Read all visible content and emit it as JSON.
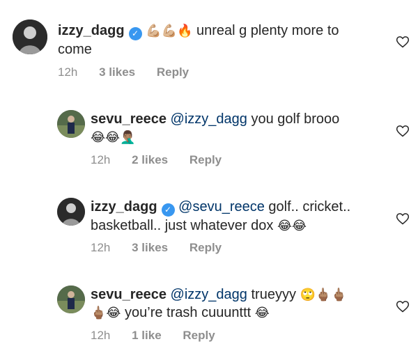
{
  "comments": [
    {
      "username": "izzy_dagg",
      "verified": true,
      "emojis": "💪🏼💪🏼🔥",
      "text": "unreal g plenty more to come",
      "time": "12h",
      "likes": "3 likes",
      "reply": "Reply"
    },
    {
      "username": "sevu_reece",
      "verified": false,
      "mention": "@izzy_dagg",
      "text": "you golf brooo",
      "emojis": "😂😂🤦🏽‍♂️",
      "time": "12h",
      "likes": "2 likes",
      "reply": "Reply"
    },
    {
      "username": "izzy_dagg",
      "verified": true,
      "mention": "@sevu_reece",
      "text": "golf.. cricket.. basketball.. just whatever dox",
      "emojis": "😂😂",
      "time": "12h",
      "likes": "3 likes",
      "reply": "Reply"
    },
    {
      "username": "sevu_reece",
      "verified": false,
      "mention": "@izzy_dagg",
      "text_a": "trueyyy",
      "emojis_a": "🙄🖕🏽🖕🏽",
      "emojis_b": "🖕🏽😂",
      "text_b": "you’re trash cuuunttt",
      "emojis_c": "😂",
      "time": "12h",
      "likes": "1 like",
      "reply": "Reply"
    }
  ],
  "icons": {
    "heart": "heart-outline-icon",
    "verified": "verified-badge-icon"
  },
  "colors": {
    "text": "#262626",
    "meta": "#8e8e8e",
    "mention": "#003569",
    "verified": "#3897f0"
  }
}
